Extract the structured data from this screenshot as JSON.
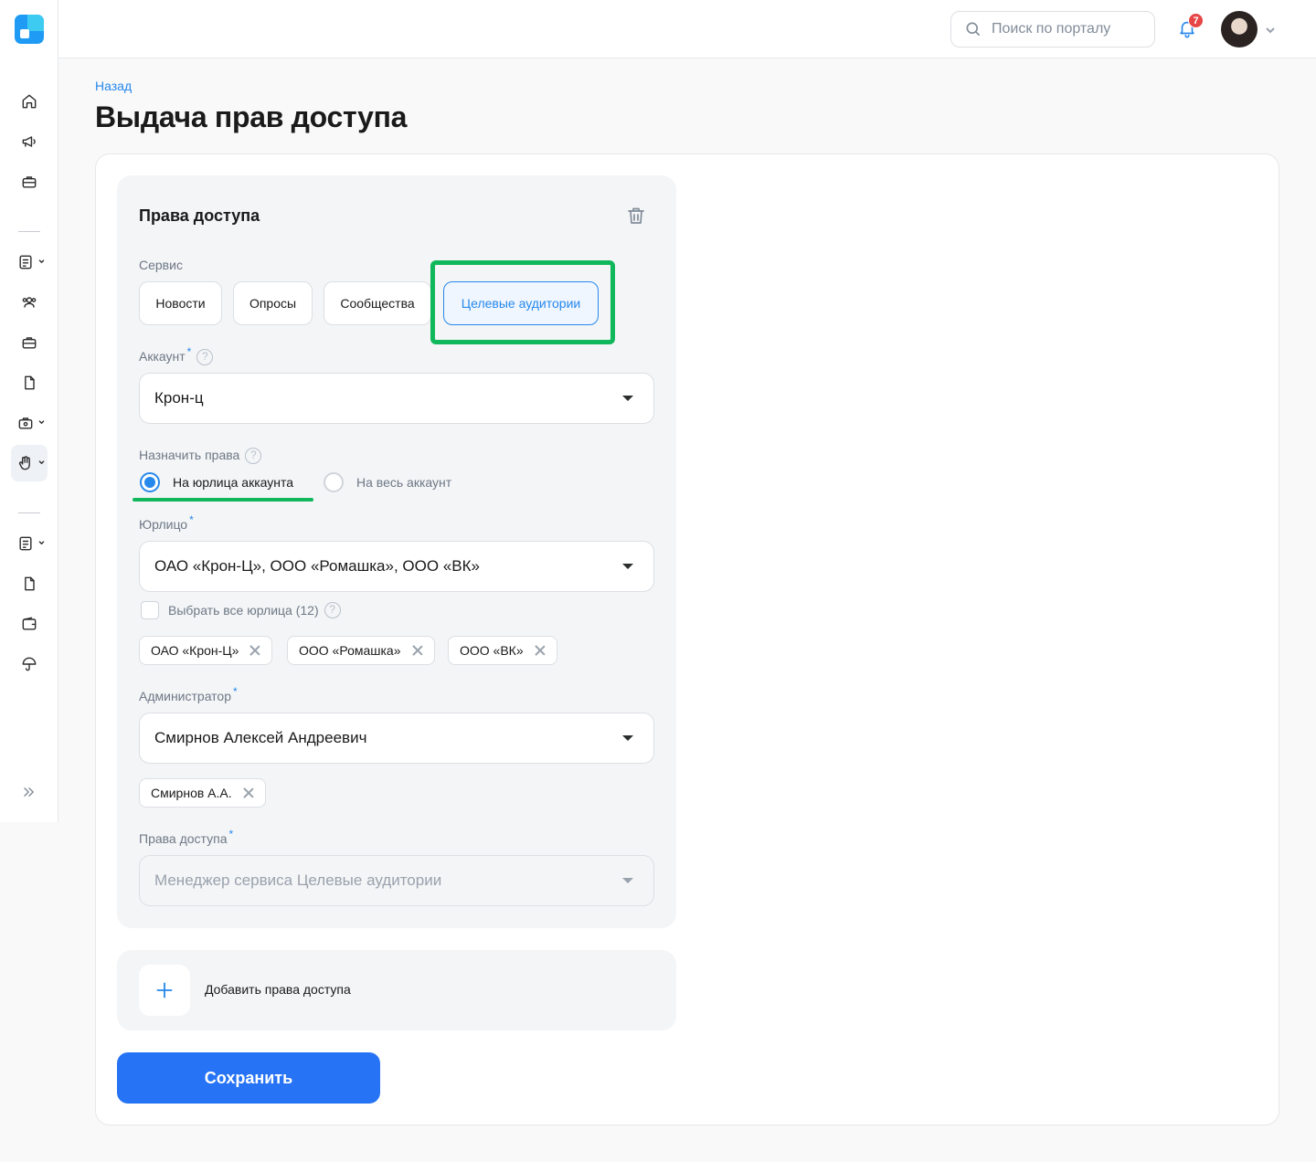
{
  "header": {
    "search_placeholder": "Поиск по порталу",
    "notifications_count": "7"
  },
  "page": {
    "back_link": "Назад",
    "title": "Выдача прав доступа"
  },
  "form": {
    "panel_title": "Права доступа",
    "service": {
      "label": "Сервис",
      "options": [
        "Новости",
        "Опросы",
        "Сообщества",
        "Целевые аудитории"
      ],
      "selected": "Целевые аудитории"
    },
    "account": {
      "label": "Аккаунт",
      "required_mark": "*",
      "help": "?",
      "value": "Крон-ц"
    },
    "assign_rights": {
      "label": "Назначить права",
      "help": "?",
      "option_legal": "На юрлица аккаунта",
      "option_all": "На весь аккаунт",
      "selected": "На юрлица аккаунта"
    },
    "legal_entity": {
      "label": "Юрлицо",
      "required_mark": "*",
      "value": "ОАО «Крон-Ц», ООО «Ромашка», ООО «ВК»",
      "select_all_label": "Выбрать все юрлица (12)",
      "help": "?",
      "tags": [
        "ОАО «Крон-Ц»",
        "ООО «Ромашка»",
        "ООО «ВК»"
      ]
    },
    "administrator": {
      "label": "Администратор",
      "required_mark": "*",
      "value": "Смирнов Алексей Андреевич",
      "tags": [
        "Смирнов А.А."
      ]
    },
    "access_rights": {
      "label": "Права доступа",
      "required_mark": "*",
      "value": "Менеджер сервиса Целевые аудитории"
    },
    "add_rights_label": "Добавить права доступа",
    "save_label": "Сохранить"
  },
  "colors": {
    "accent": "#2688eb",
    "primary_button": "#2673f5",
    "highlight": "#11b85b",
    "badge": "#e64646"
  }
}
